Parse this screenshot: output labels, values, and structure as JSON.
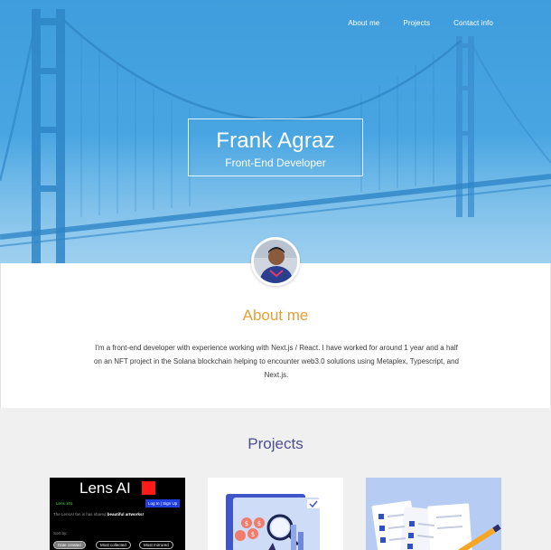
{
  "nav": {
    "items": [
      {
        "label": "About me"
      },
      {
        "label": "Projects"
      },
      {
        "label": "Contact info"
      }
    ]
  },
  "hero": {
    "name": "Frank Agraz",
    "role": "Front-End Developer"
  },
  "about": {
    "heading": "About me",
    "text": "I'm a front-end developer with experience working with Next.js / React. I have worked for around 1 year and a half on an NFT project in the Solana blockchain helping to encounter web3.0 solutions using Metaplex, Typescript, and Next.js."
  },
  "projects": {
    "heading": "Projects",
    "lens": {
      "title": "Lens AI",
      "tag": "Lens 101",
      "login": "Log In | Sign Up",
      "intro_prefix": "The LensAI fan is has shared ",
      "intro_bold": "beautiful artworks!",
      "sort_label": "Sort by:",
      "chips": [
        "Date created",
        "Most collected",
        "Most mirrored"
      ]
    }
  },
  "colors": {
    "hero_blue": "#4aa6e2",
    "about_heading": "#e4a039",
    "projects_heading": "#4a4f8f"
  }
}
